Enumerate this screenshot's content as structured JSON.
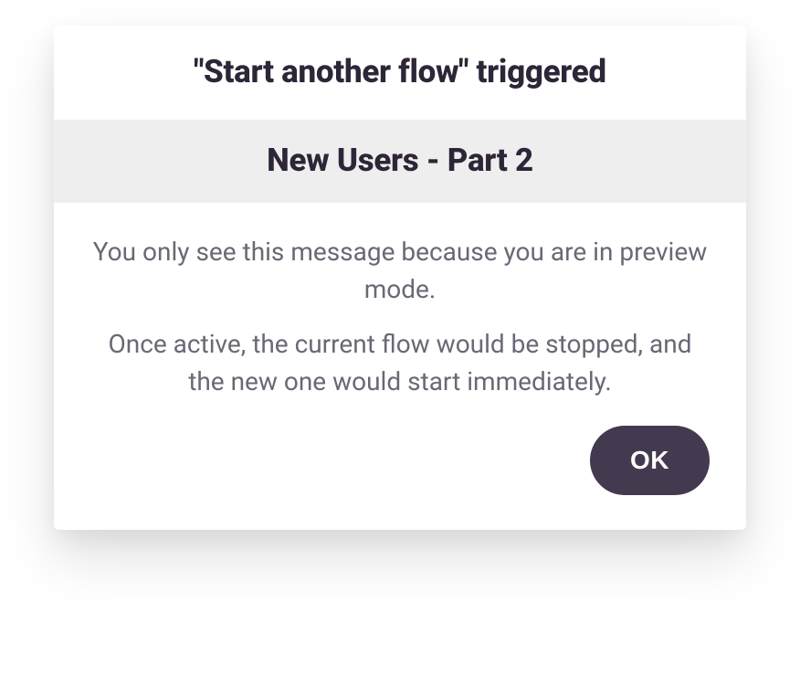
{
  "modal": {
    "title": "\"Start another flow\" triggered",
    "subtitle": "New Users - Part 2",
    "body_text_1": "You only see this message because you are in preview mode.",
    "body_text_2": "Once active, the current flow would be stopped, and the new one would start immediately.",
    "ok_label": "OK"
  }
}
